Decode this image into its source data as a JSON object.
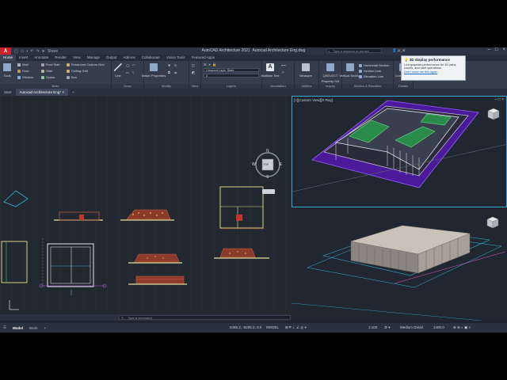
{
  "app": {
    "title": "AutoCAD Architecture 2021",
    "document": "Autocad Architecture Eng.dwg",
    "share_label": "Share",
    "search_placeholder": "Type a keyword or phrase",
    "user": "jo_al"
  },
  "ribbon_tabs": [
    "Home",
    "Insert",
    "Annotate",
    "Render",
    "View",
    "Manage",
    "Output",
    "Add-ins",
    "Collaborate",
    "Vision Tools",
    "Featured Apps"
  ],
  "ribbon": {
    "panels": [
      {
        "label": "Build",
        "items": [
          "Wall",
          "Door",
          "Window",
          "Roof Slab",
          "Stair",
          "Space",
          "Enhanced Custom Grid",
          "Ceiling Grid",
          "Box"
        ],
        "big": "Tools"
      },
      {
        "label": "Draw",
        "items": [
          "Line"
        ]
      },
      {
        "label": "Modify",
        "items": [
          "Match Properties"
        ]
      },
      {
        "label": "View",
        "items": []
      },
      {
        "label": "Layers",
        "items": [
          "Unsaved Layer State",
          "0"
        ]
      },
      {
        "label": "Annotation",
        "items": [
          "Multiline Text"
        ]
      },
      {
        "label": "Utilities",
        "items": [
          "Measure"
        ]
      },
      {
        "label": "Inquiry",
        "items": [
          "QSELECT",
          "Property Set"
        ]
      },
      {
        "label": "Section & Elevation",
        "items": [
          "Vertical Section",
          "Horizontal Section",
          "Section Line",
          "Elevation Line"
        ]
      },
      {
        "label": "Details",
        "items": [
          "Component"
        ]
      }
    ]
  },
  "doc_tabs": [
    "Start",
    "Autocad Architecture Eng*"
  ],
  "viewports": {
    "top_right": "[+][Custom View][X-Ray]"
  },
  "viewcube": {
    "n": "N",
    "s": "S",
    "e": "E",
    "w": "W",
    "top": "TOP"
  },
  "command": {
    "placeholder": "Type a command"
  },
  "status": {
    "layout_tabs": [
      "Model",
      "Work"
    ],
    "coords": "5485.2, -6205.2, 0.0",
    "model": "MODEL",
    "scale": "1:100",
    "detail": "Medium Detail",
    "cut_plane": "1400.0"
  },
  "tooltip": {
    "title": "3D display performance",
    "body": "Low graphics performance for 3D pans, zooms, and orbit operations.",
    "link": "Don't show me this again"
  },
  "colors": {
    "accent": "#3aa5d8",
    "purple": "#5a1fa0",
    "app_red": "#c8232c"
  }
}
